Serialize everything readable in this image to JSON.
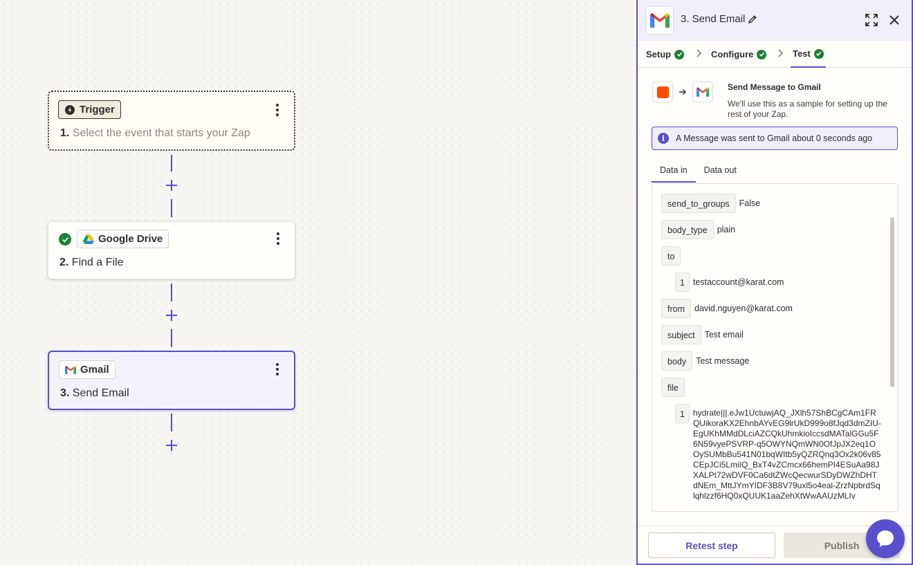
{
  "canvas": {
    "trigger": {
      "badge": "Trigger",
      "number": "1.",
      "text": "Select the event that starts your Zap"
    },
    "drive": {
      "badge": "Google Drive",
      "number": "2.",
      "text": "Find a File"
    },
    "gmail": {
      "badge": "Gmail",
      "number": "3.",
      "text": "Send Email"
    }
  },
  "panel": {
    "title": "3. Send Email",
    "tabs": [
      {
        "label": "Setup",
        "status": "complete"
      },
      {
        "label": "Configure",
        "status": "complete"
      },
      {
        "label": "Test",
        "status": "complete",
        "active": true
      }
    ],
    "sample": {
      "title": "Send Message to Gmail",
      "description": "We'll use this as a sample for setting up the rest of your Zap."
    },
    "info": "A Message was sent to Gmail about 0 seconds ago",
    "data_tabs": [
      "Data in",
      "Data out"
    ],
    "fields": {
      "send_to_groups": {
        "key": "send_to_groups",
        "value": "False"
      },
      "body_type": {
        "key": "body_type",
        "value": "plain"
      },
      "to": {
        "key": "to",
        "index": "1",
        "value": "testaccount@karat.com"
      },
      "from": {
        "key": "from",
        "value": "david.nguyen@karat.com"
      },
      "subject": {
        "key": "subject",
        "value": "Test email"
      },
      "body": {
        "key": "body",
        "value": "Test message"
      },
      "file": {
        "key": "file",
        "index": "1",
        "value": "hydrate|||.eJw1UctuwjAQ_JXlh57ShBCgCAm1FRQUikoraKX2EhnbAYvEG9lrUkD999o8fJqd3dmZIU-EgUKhMMdDLciAZCQkUhmkioIccsdMATalGGu5F6N59vyePSVRP-q5OWYNQmWN0OfJpJX2eq1OOySUMbBu541N01bqWItb5yQZRQnq3Ox2k06v85CEpJCi5LmiIQ_BxT4vZCmcx66hemPI4ESuAa98JXALPt72wDVF0Ca6dtZWcQecwurSDyDWZhDHTdNEm_MttJYmYIDF3B8V79uxl5o4eal-ZrzNpbrdSqlqhlzzf6HQ0xQUUK1aaZehXtWwAAUzMLIv"
      }
    },
    "buttons": {
      "retest": "Retest step",
      "publish": "Publish"
    }
  },
  "colors": {
    "accent": "#5a4fcf",
    "success": "#1a7f37",
    "brand_orange": "#ff4f00"
  }
}
